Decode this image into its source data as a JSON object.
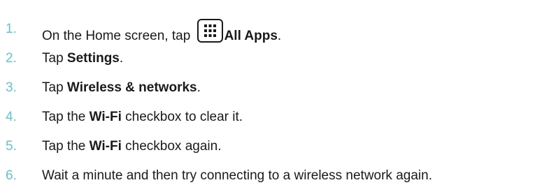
{
  "steps": [
    {
      "number": "1.",
      "before": "On the Home screen, tap ",
      "icon": "all-apps-grid-icon",
      "bold": "All Apps",
      "after": "."
    },
    {
      "number": "2.",
      "before": "Tap ",
      "bold": "Settings",
      "after": "."
    },
    {
      "number": "3.",
      "before": "Tap ",
      "bold": "Wireless & networks",
      "after": "."
    },
    {
      "number": "4.",
      "before": "Tap the ",
      "bold": "Wi-Fi",
      "after": " checkbox to clear it."
    },
    {
      "number": "5.",
      "before": "Tap the ",
      "bold": "Wi-Fi",
      "after": " checkbox again."
    },
    {
      "number": "6.",
      "text": "Wait a minute and then try connecting to a wireless network again."
    }
  ],
  "colors": {
    "number": "#64c5cf",
    "text": "#1a1a1a"
  }
}
